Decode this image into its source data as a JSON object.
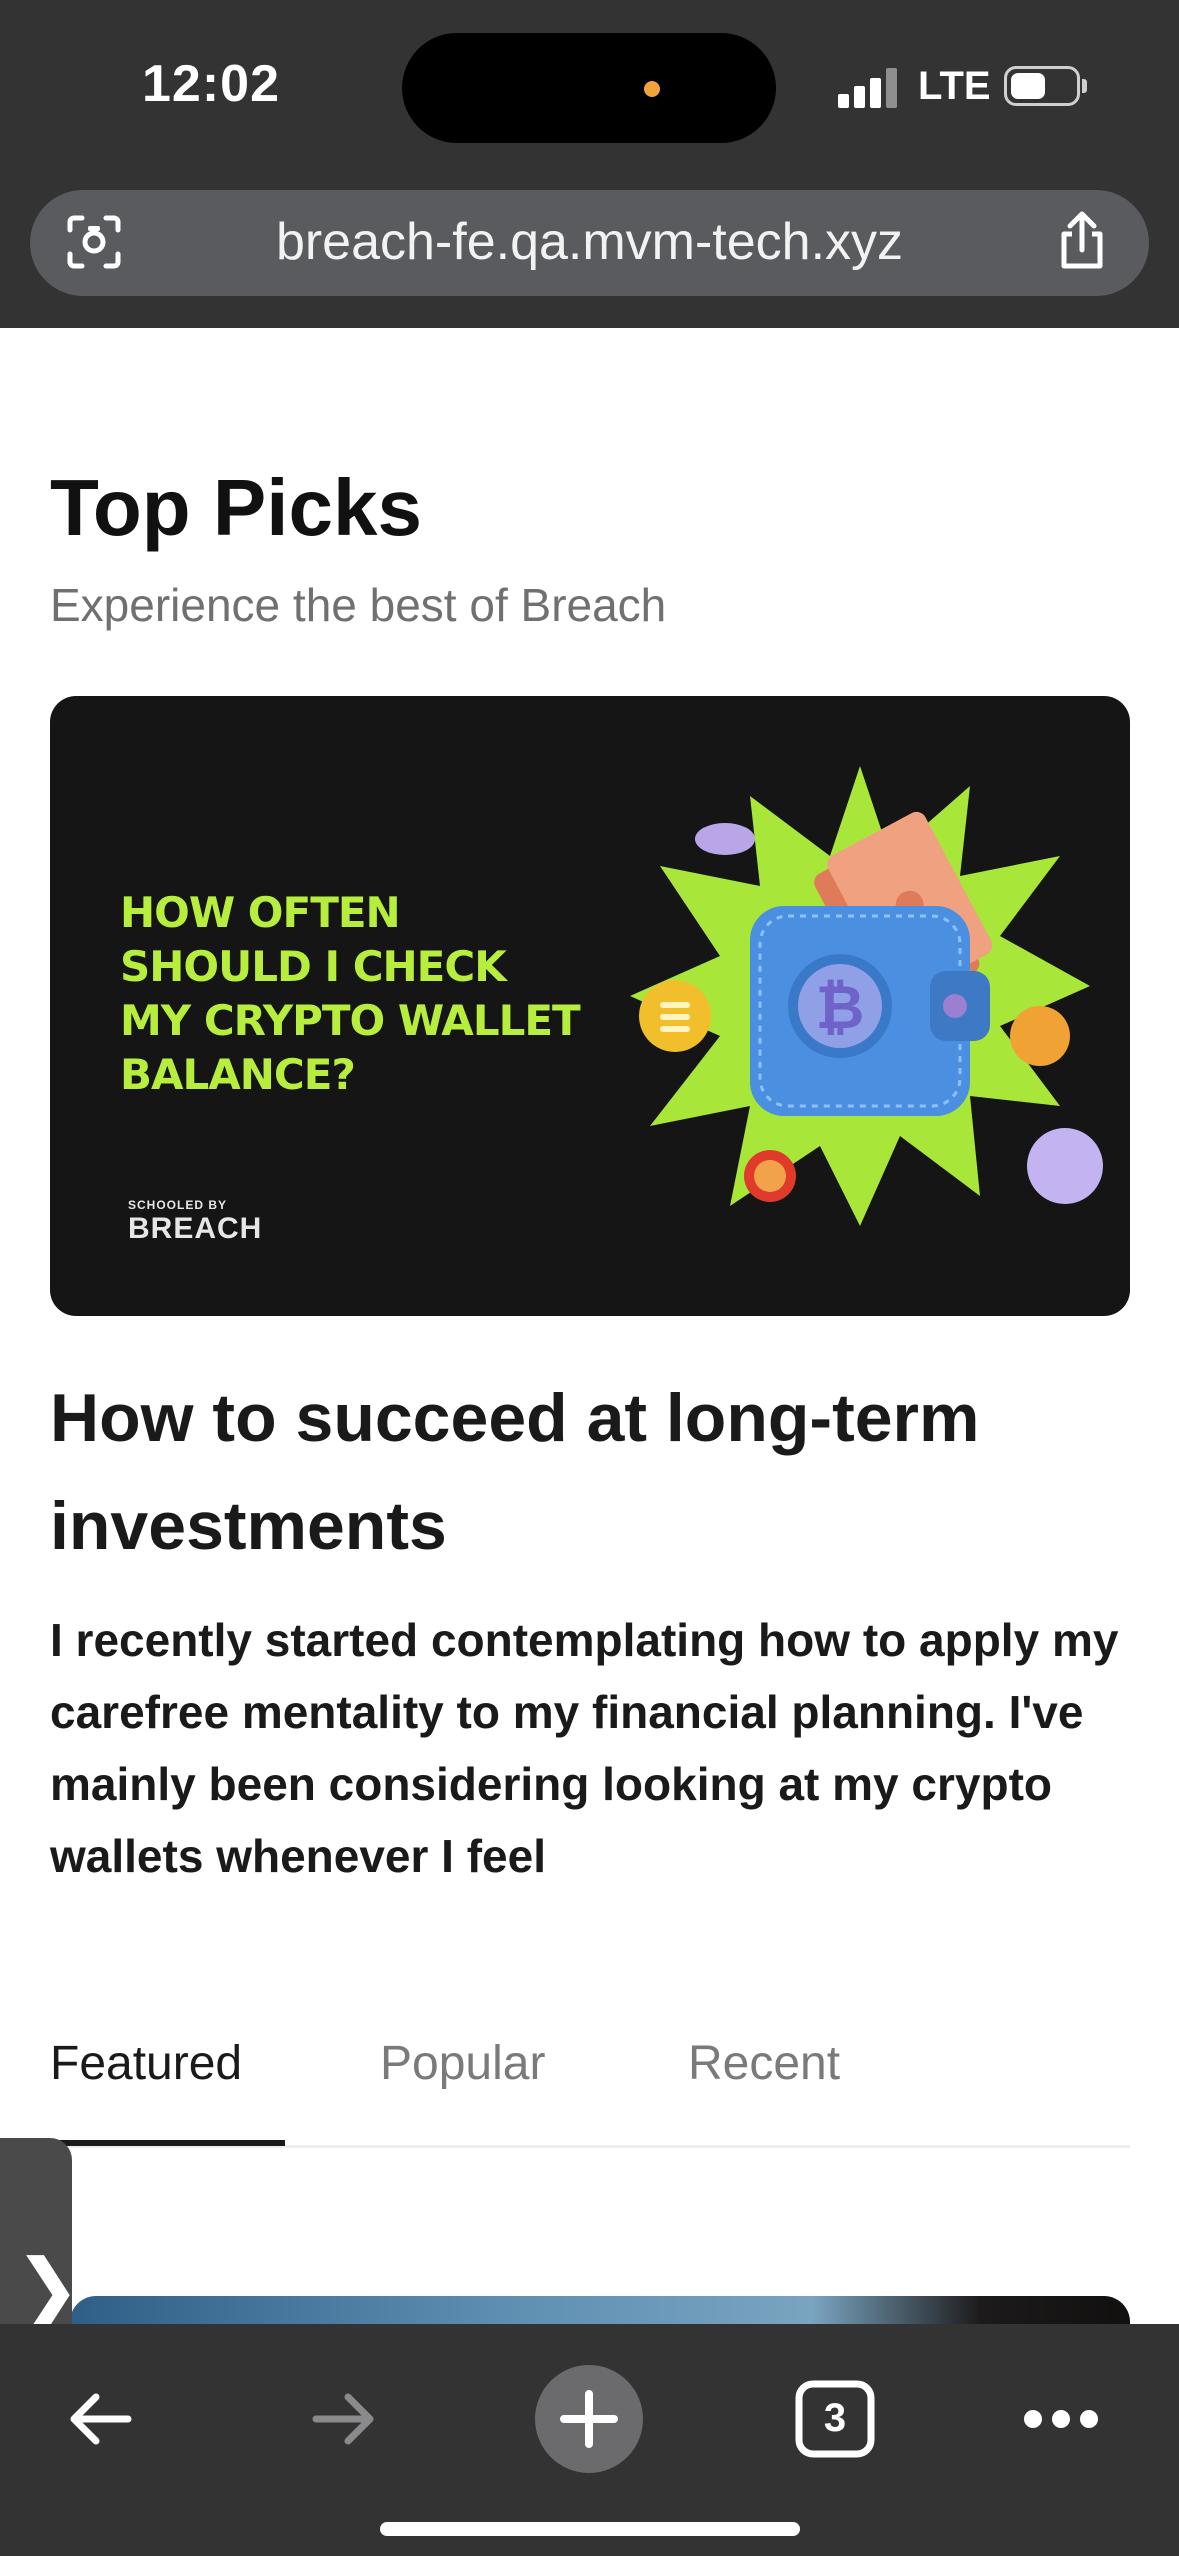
{
  "status_bar": {
    "time": "12:02",
    "network": "LTE"
  },
  "browser": {
    "url": "breach-fe.qa.mvm-tech.xyz",
    "tab_count": "3"
  },
  "section": {
    "title": "Top Picks",
    "subtitle": "Experience the best of Breach"
  },
  "hero": {
    "headline": "HOW OFTEN\nSHOULD I CHECK\nMY CRYPTO WALLET\nBALANCE?",
    "brand_small": "SCHOOLED BY",
    "brand": "BREACH"
  },
  "article": {
    "title": "How to succeed at long-term investments",
    "excerpt": "I recently started contemplating how to apply my carefree mentality to my financial planning. I've mainly been considering looking at my crypto wallets whenever I feel"
  },
  "tabs": [
    {
      "label": "Featured",
      "active": true
    },
    {
      "label": "Popular",
      "active": false
    },
    {
      "label": "Recent",
      "active": false
    }
  ],
  "side_handle": {
    "glyph": "❯"
  },
  "colors": {
    "chrome": "#333334",
    "hero_accent": "#b7ee3e",
    "hero_bg": "#151515"
  }
}
